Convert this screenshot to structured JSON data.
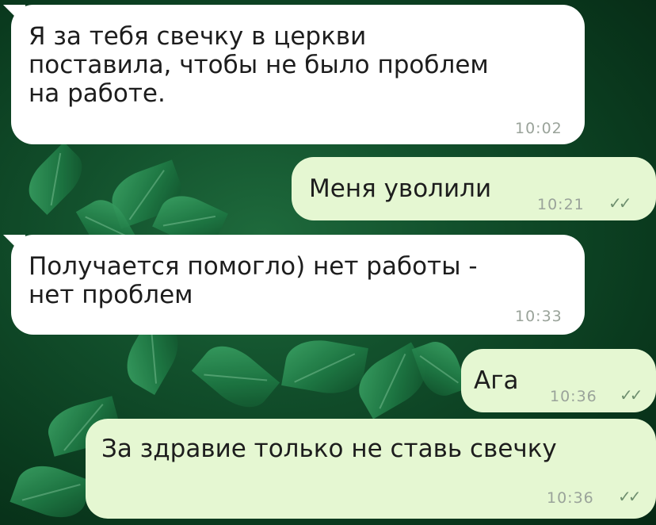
{
  "chat": {
    "messages": [
      {
        "text": "Я за тебя свечку в церкви\nпоставила, чтобы не было проблем\nна работе.",
        "time": "10:02"
      },
      {
        "text": "Меня уволили",
        "time": "10:21",
        "ticks": "✓✓"
      },
      {
        "text": "Получается помогло) нет работы -\nнет проблем",
        "time": "10:33"
      },
      {
        "text": "Ага",
        "time": "10:36",
        "ticks": "✓✓"
      },
      {
        "text": "За здравие только не ставь свечку",
        "time": "10:36",
        "ticks": "✓✓"
      }
    ]
  },
  "colors": {
    "incoming_bubble": "#ffffff",
    "outgoing_bubble": "#e5f7d2",
    "background": "#12502c",
    "read_ticks": "#6f8f6f"
  },
  "icons": {
    "read_receipt": "double-check-icon"
  }
}
